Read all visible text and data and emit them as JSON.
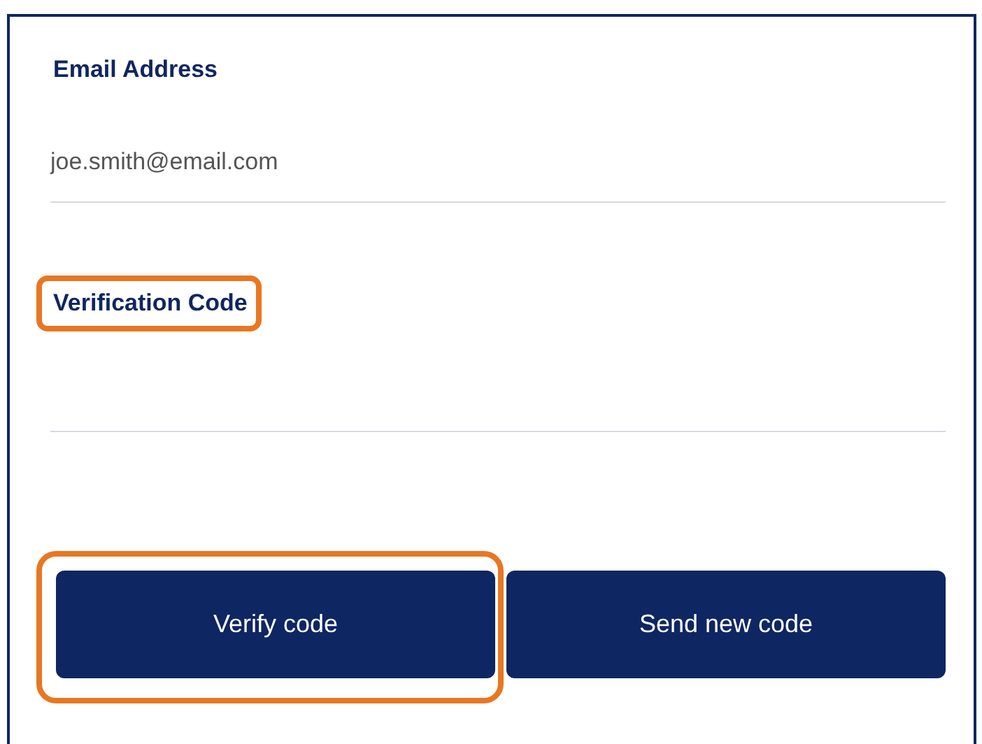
{
  "fields": [
    {
      "label": "Email Address",
      "label_highlighted": false,
      "value": "joe.smith@email.com"
    },
    {
      "label": "Verification Code",
      "label_highlighted": true
    }
  ],
  "buttons": [
    {
      "label": "Verify code",
      "highlighted": true
    },
    {
      "label": "Send new code",
      "highlighted": false
    }
  ]
}
